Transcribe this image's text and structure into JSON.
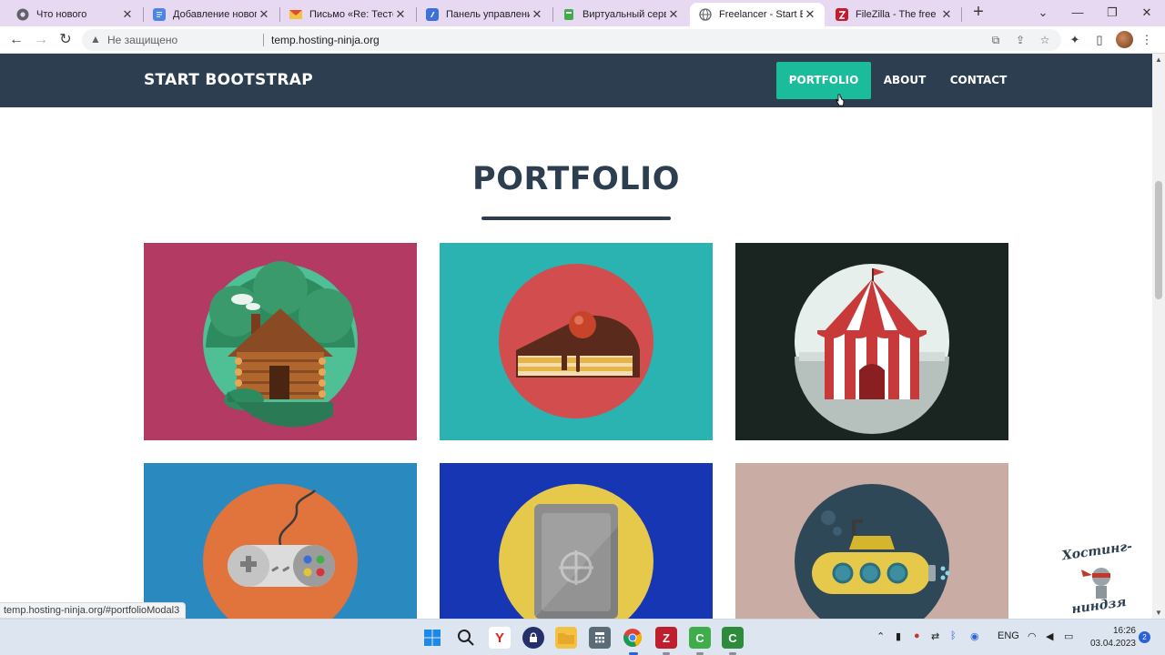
{
  "browser": {
    "tabs": [
      {
        "title": "Что нового",
        "icon": "chrome-icon"
      },
      {
        "title": "Добавление нового",
        "icon": "docs-icon"
      },
      {
        "title": "Письмо «Re: Тестовы",
        "icon": "mail-icon"
      },
      {
        "title": "Панель управления",
        "icon": "panel-icon"
      },
      {
        "title": "Виртуальный сервер",
        "icon": "server-icon"
      },
      {
        "title": "Freelancer - Start Boo",
        "icon": "globe-icon",
        "active": true
      },
      {
        "title": "FileZilla - The free FTP",
        "icon": "filezilla-icon"
      }
    ],
    "new_tab": "+",
    "address": {
      "security_label": "Не защищено",
      "url": "temp.hosting-ninja.org"
    },
    "status_url": "temp.hosting-ninja.org/#portfolioModal3"
  },
  "site": {
    "brand": "START BOOTSTRAP",
    "nav": [
      "PORTFOLIO",
      "ABOUT",
      "CONTACT"
    ],
    "active_nav": "PORTFOLIO",
    "section_title": "PORTFOLIO",
    "portfolio_items": [
      {
        "name": "cabin",
        "bg": "#b33a63"
      },
      {
        "name": "cake",
        "bg": "#2bb3b1"
      },
      {
        "name": "circus",
        "bg": "#1a2420"
      },
      {
        "name": "game",
        "bg": "#2a8ac0"
      },
      {
        "name": "safe",
        "bg": "#1736b3"
      },
      {
        "name": "submarine",
        "bg": "#c9ada4"
      }
    ],
    "colors": {
      "nav_bg": "#2c3e50",
      "accent": "#1abc9c",
      "heading": "#2c3e50"
    }
  },
  "watermark": {
    "text_top": "Хостинг-",
    "text_bottom": "ниндзя"
  },
  "taskbar": {
    "language": "ENG",
    "time": "16:26",
    "date": "03.04.2023",
    "notifications": "2"
  }
}
